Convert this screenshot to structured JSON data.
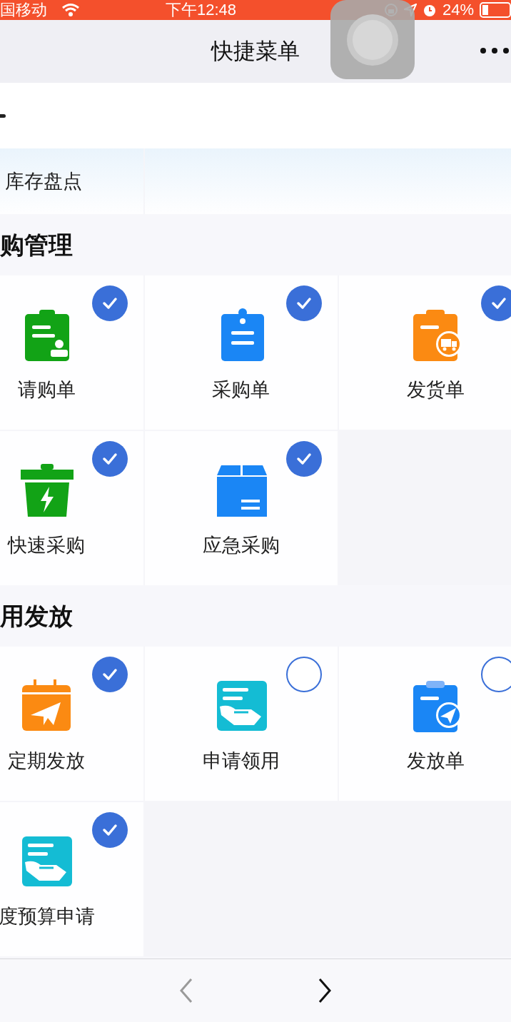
{
  "status_bar": {
    "carrier": "国移动",
    "time": "下午12:48",
    "battery": "24%"
  },
  "nav_bar": {
    "title": "快捷菜单"
  },
  "partial_row": {
    "items": [
      {
        "label": "库存盘点"
      }
    ]
  },
  "sections": [
    {
      "title": "购管理",
      "items": [
        {
          "label": "请购单",
          "kind": "clipboard-person",
          "selected": true
        },
        {
          "label": "采购单",
          "kind": "clipboard",
          "selected": true
        },
        {
          "label": "发货单",
          "kind": "clipboard-truck",
          "selected": true
        },
        {
          "label": "快速采购",
          "kind": "bin-bolt",
          "selected": true
        },
        {
          "label": "应急采购",
          "kind": "box",
          "selected": true
        }
      ]
    },
    {
      "title": "用发放",
      "items": [
        {
          "label": "定期发放",
          "kind": "calendar-plane",
          "selected": true
        },
        {
          "label": "申请领用",
          "kind": "hand-document",
          "selected": false
        },
        {
          "label": "发放单",
          "kind": "clipboard-plane",
          "selected": false
        },
        {
          "label": "度预算申请",
          "kind": "hand-document",
          "selected": true
        }
      ]
    }
  ],
  "pager": {
    "previous": {
      "disabled": true
    },
    "next": {
      "disabled": false
    }
  }
}
